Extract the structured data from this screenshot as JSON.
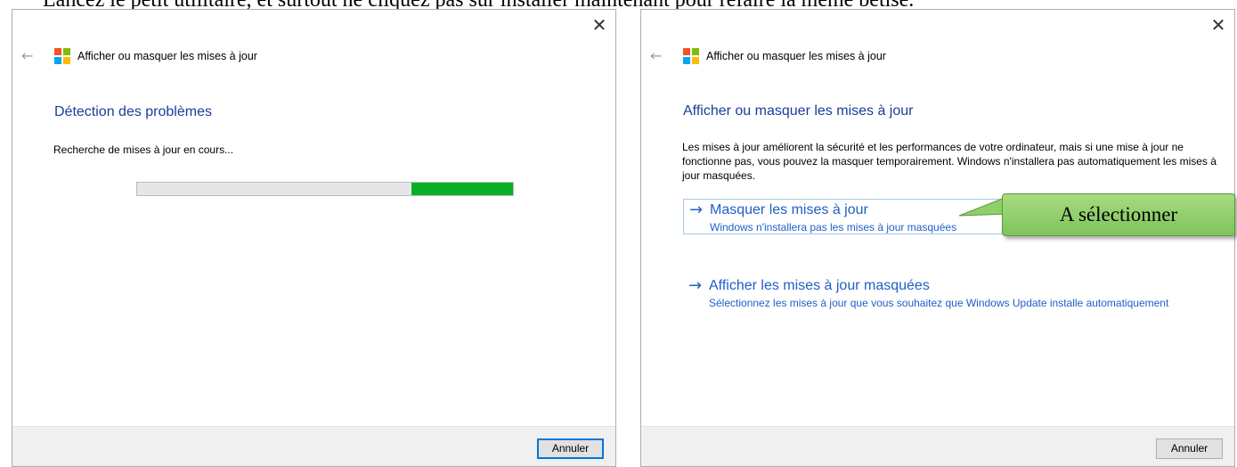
{
  "caption": "Lancez le petit utilitaire, et surtout ne cliquez pas sur installer maintenant pour refaire la même bêtise.",
  "left_window": {
    "title": "Afficher ou masquer les mises à jour",
    "heading": "Détection des problèmes",
    "status": "Recherche de mises à jour en cours...",
    "progress_fraction": 0.27,
    "cancel_label": "Annuler"
  },
  "right_window": {
    "title": "Afficher ou masquer les mises à jour",
    "heading": "Afficher ou masquer les mises à jour",
    "description": "Les mises à jour améliorent la sécurité et les performances de votre ordinateur, mais si une mise à jour ne fonctionne pas, vous pouvez la masquer temporairement. Windows n'installera pas automatiquement les mises à jour masquées.",
    "options": [
      {
        "title": "Masquer les mises à jour",
        "subtitle": "Windows n'installera pas les mises à jour masquées"
      },
      {
        "title": "Afficher les mises à jour masquées",
        "subtitle": "Sélectionnez les mises à jour que vous souhaitez que Windows Update installe automatiquement"
      }
    ],
    "cancel_label": "Annuler"
  },
  "callout": {
    "text": "A sélectionner",
    "color": "#8fd06a"
  },
  "icons": {
    "close": "close-icon",
    "back": "back-arrow-icon",
    "logo": "windows-logo-icon",
    "option_arrow": "right-arrow-icon"
  }
}
